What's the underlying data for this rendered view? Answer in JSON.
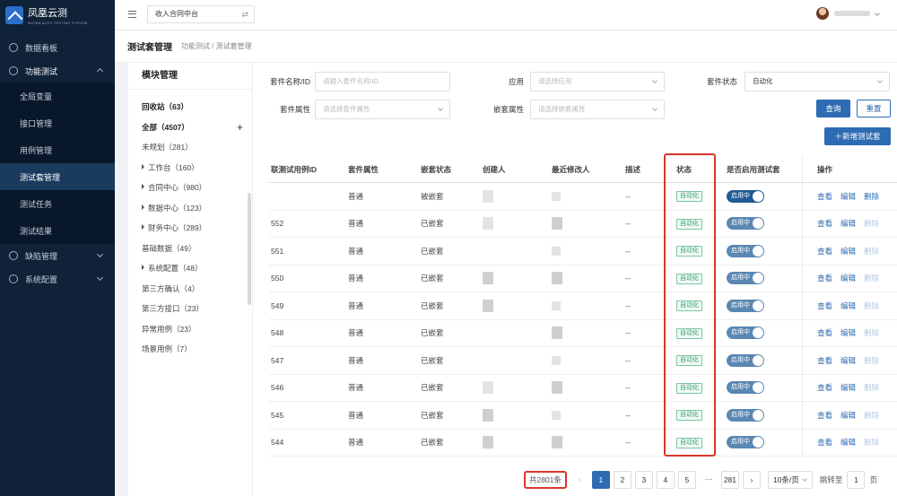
{
  "app": {
    "logo_title": "凤凰云测",
    "logo_subtitle": "BOYAN AUTO TESTING SYSTEM"
  },
  "sidebar": {
    "items": [
      {
        "label": "数据看板",
        "icon": "dashboard-icon"
      },
      {
        "label": "功能测试",
        "icon": "cube-icon",
        "open": true,
        "children": [
          "全局变量",
          "接口管理",
          "用例管理",
          "测试套管理",
          "测试任务",
          "测试结果"
        ],
        "active_child": "测试套管理"
      },
      {
        "label": "缺陷管理",
        "icon": "bug-icon"
      },
      {
        "label": "系统配置",
        "icon": "gear-icon"
      }
    ]
  },
  "topbar": {
    "context_select": "收入合同中台"
  },
  "breadcrumb": {
    "title": "测试套管理",
    "path": "功能测试  /  测试套管理"
  },
  "tree": {
    "title": "模块管理",
    "nodes": [
      {
        "label": "回收站（63）",
        "bold": true
      },
      {
        "label": "全部（4507）",
        "bold": true,
        "add": "+"
      },
      {
        "label": "未规划（281）"
      },
      {
        "label": "工作台（160）",
        "arrow": true
      },
      {
        "label": "合同中心（980）",
        "arrow": true
      },
      {
        "label": "数据中心（123）",
        "arrow": true
      },
      {
        "label": "财务中心（289）",
        "arrow": true
      },
      {
        "label": "基础数据（49）"
      },
      {
        "label": "系统配置（48）",
        "arrow": true
      },
      {
        "label": "第三方确认（4）"
      },
      {
        "label": "第三方接口（23）"
      },
      {
        "label": "异常用例（23）"
      },
      {
        "label": "场景用例（7）"
      }
    ]
  },
  "filters": {
    "suite_name_label": "套件名称/ID",
    "suite_name_placeholder": "请输入套件名称/ID",
    "app_label": "应用",
    "app_placeholder": "请选择应用",
    "status_label": "套件状态",
    "status_value": "自动化",
    "attr_label": "套件属性",
    "attr_placeholder": "请选择套件属性",
    "nest_label": "嵌套属性",
    "nest_placeholder": "请选择嵌套属性",
    "query": "查询",
    "reset": "重置",
    "add": "＋新增测试套"
  },
  "table": {
    "headers": [
      "联测试用例ID",
      "套件属性",
      "嵌套状态",
      "创建人",
      "最近修改人",
      "描述",
      "状态",
      "是否启用测试套",
      "操作"
    ],
    "rows": [
      {
        "id": "",
        "attr": "普通",
        "nest": "被嵌套",
        "desc": "--",
        "status": "自动化",
        "toggle": "启用中",
        "ops": [
          "查看",
          "编辑",
          "删除"
        ],
        "del_disabled": false
      },
      {
        "id": "552",
        "attr": "普通",
        "nest": "已嵌套",
        "desc": "--",
        "status": "自动化",
        "toggle": "启用中",
        "ops": [
          "查看",
          "编辑",
          "删除"
        ],
        "del_disabled": true
      },
      {
        "id": "551",
        "attr": "普通",
        "nest": "已嵌套",
        "desc": "--",
        "status": "自动化",
        "toggle": "启用中",
        "ops": [
          "查看",
          "编辑",
          "删除"
        ],
        "del_disabled": true
      },
      {
        "id": "550",
        "attr": "普通",
        "nest": "已嵌套",
        "desc": "--",
        "status": "自动化",
        "toggle": "启用中",
        "ops": [
          "查看",
          "编辑",
          "删除"
        ],
        "del_disabled": true
      },
      {
        "id": "549",
        "attr": "普通",
        "nest": "已嵌套",
        "desc": "--",
        "status": "自动化",
        "toggle": "启用中",
        "ops": [
          "查看",
          "编辑",
          "删除"
        ],
        "del_disabled": true
      },
      {
        "id": "548",
        "attr": "普通",
        "nest": "已嵌套",
        "desc": "--",
        "status": "自动化",
        "toggle": "启用中",
        "ops": [
          "查看",
          "编辑",
          "删除"
        ],
        "del_disabled": true
      },
      {
        "id": "547",
        "attr": "普通",
        "nest": "已嵌套",
        "desc": "--",
        "status": "自动化",
        "toggle": "启用中",
        "ops": [
          "查看",
          "编辑",
          "删除"
        ],
        "del_disabled": true
      },
      {
        "id": "546",
        "attr": "普通",
        "nest": "已嵌套",
        "desc": "--",
        "status": "自动化",
        "toggle": "启用中",
        "ops": [
          "查看",
          "编辑",
          "删除"
        ],
        "del_disabled": true
      },
      {
        "id": "545",
        "attr": "普通",
        "nest": "已嵌套",
        "desc": "--",
        "status": "自动化",
        "toggle": "启用中",
        "ops": [
          "查看",
          "编辑",
          "删除"
        ],
        "del_disabled": true
      },
      {
        "id": "544",
        "attr": "普通",
        "nest": "已嵌套",
        "desc": "--",
        "status": "自动化",
        "toggle": "启用中",
        "ops": [
          "查看",
          "编辑",
          "删除"
        ],
        "del_disabled": true
      }
    ]
  },
  "pagination": {
    "total": "共2801条",
    "pages": [
      "1",
      "2",
      "3",
      "4",
      "5"
    ],
    "current": "1",
    "ellipsis": "···",
    "last": "281",
    "page_size": "10条/页",
    "jump_label": "跳转至",
    "jump_value": "1",
    "jump_suffix": "页"
  },
  "colors": {
    "sidebar_bg": "#0f2238",
    "primary": "#2d6bb3",
    "highlight": "#d9362b",
    "tag_green": "#33a06b"
  }
}
